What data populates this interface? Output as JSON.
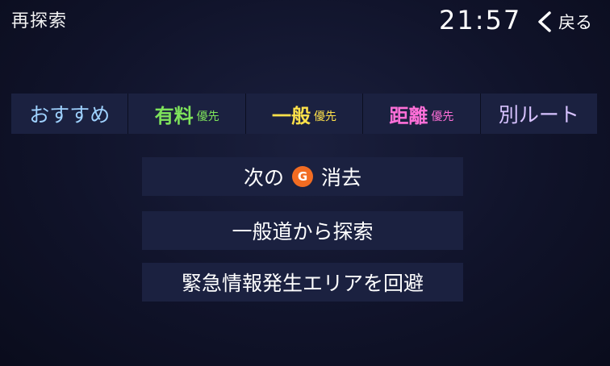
{
  "header": {
    "title": "再探索",
    "clock": "21:57",
    "back_label": "戻る"
  },
  "tabs": [
    {
      "main": "おすすめ",
      "sub": ""
    },
    {
      "main": "有料",
      "sub": "優先"
    },
    {
      "main": "一般",
      "sub": "優先"
    },
    {
      "main": "距離",
      "sub": "優先"
    },
    {
      "main": "別ルート",
      "sub": ""
    }
  ],
  "options": {
    "erase_next": {
      "prefix": "次の",
      "badge": "G",
      "suffix": "消去"
    },
    "from_general_road": "一般道から探索",
    "avoid_emergency_area": "緊急情報発生エリアを回避"
  },
  "colors": {
    "recommend": "#9fd2ff",
    "toll": "#7ee35b",
    "general": "#ffe14a",
    "distance": "#ff6fd8",
    "alt_route": "#d7c2ff",
    "goal_badge": "#f26c22"
  }
}
